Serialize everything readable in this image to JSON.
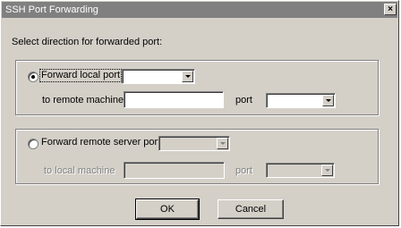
{
  "window": {
    "title": "SSH Port Forwarding",
    "close_glyph": "×"
  },
  "prompt": "Select direction for forwarded port:",
  "local_group": {
    "radio_label": "Forward local port",
    "local_port_value": "",
    "remote_machine_label": "to remote machine",
    "remote_machine_value": "",
    "port_label": "port",
    "port_value": "",
    "selected": true
  },
  "remote_group": {
    "radio_label": "Forward remote server port",
    "server_port_value": "",
    "local_machine_label": "to local machine",
    "local_machine_value": "",
    "port_label": "port",
    "port_value": "",
    "selected": false
  },
  "buttons": {
    "ok": "OK",
    "cancel": "Cancel"
  },
  "icons": {
    "close": "close-icon",
    "dropdown": "chevron-down-icon"
  }
}
